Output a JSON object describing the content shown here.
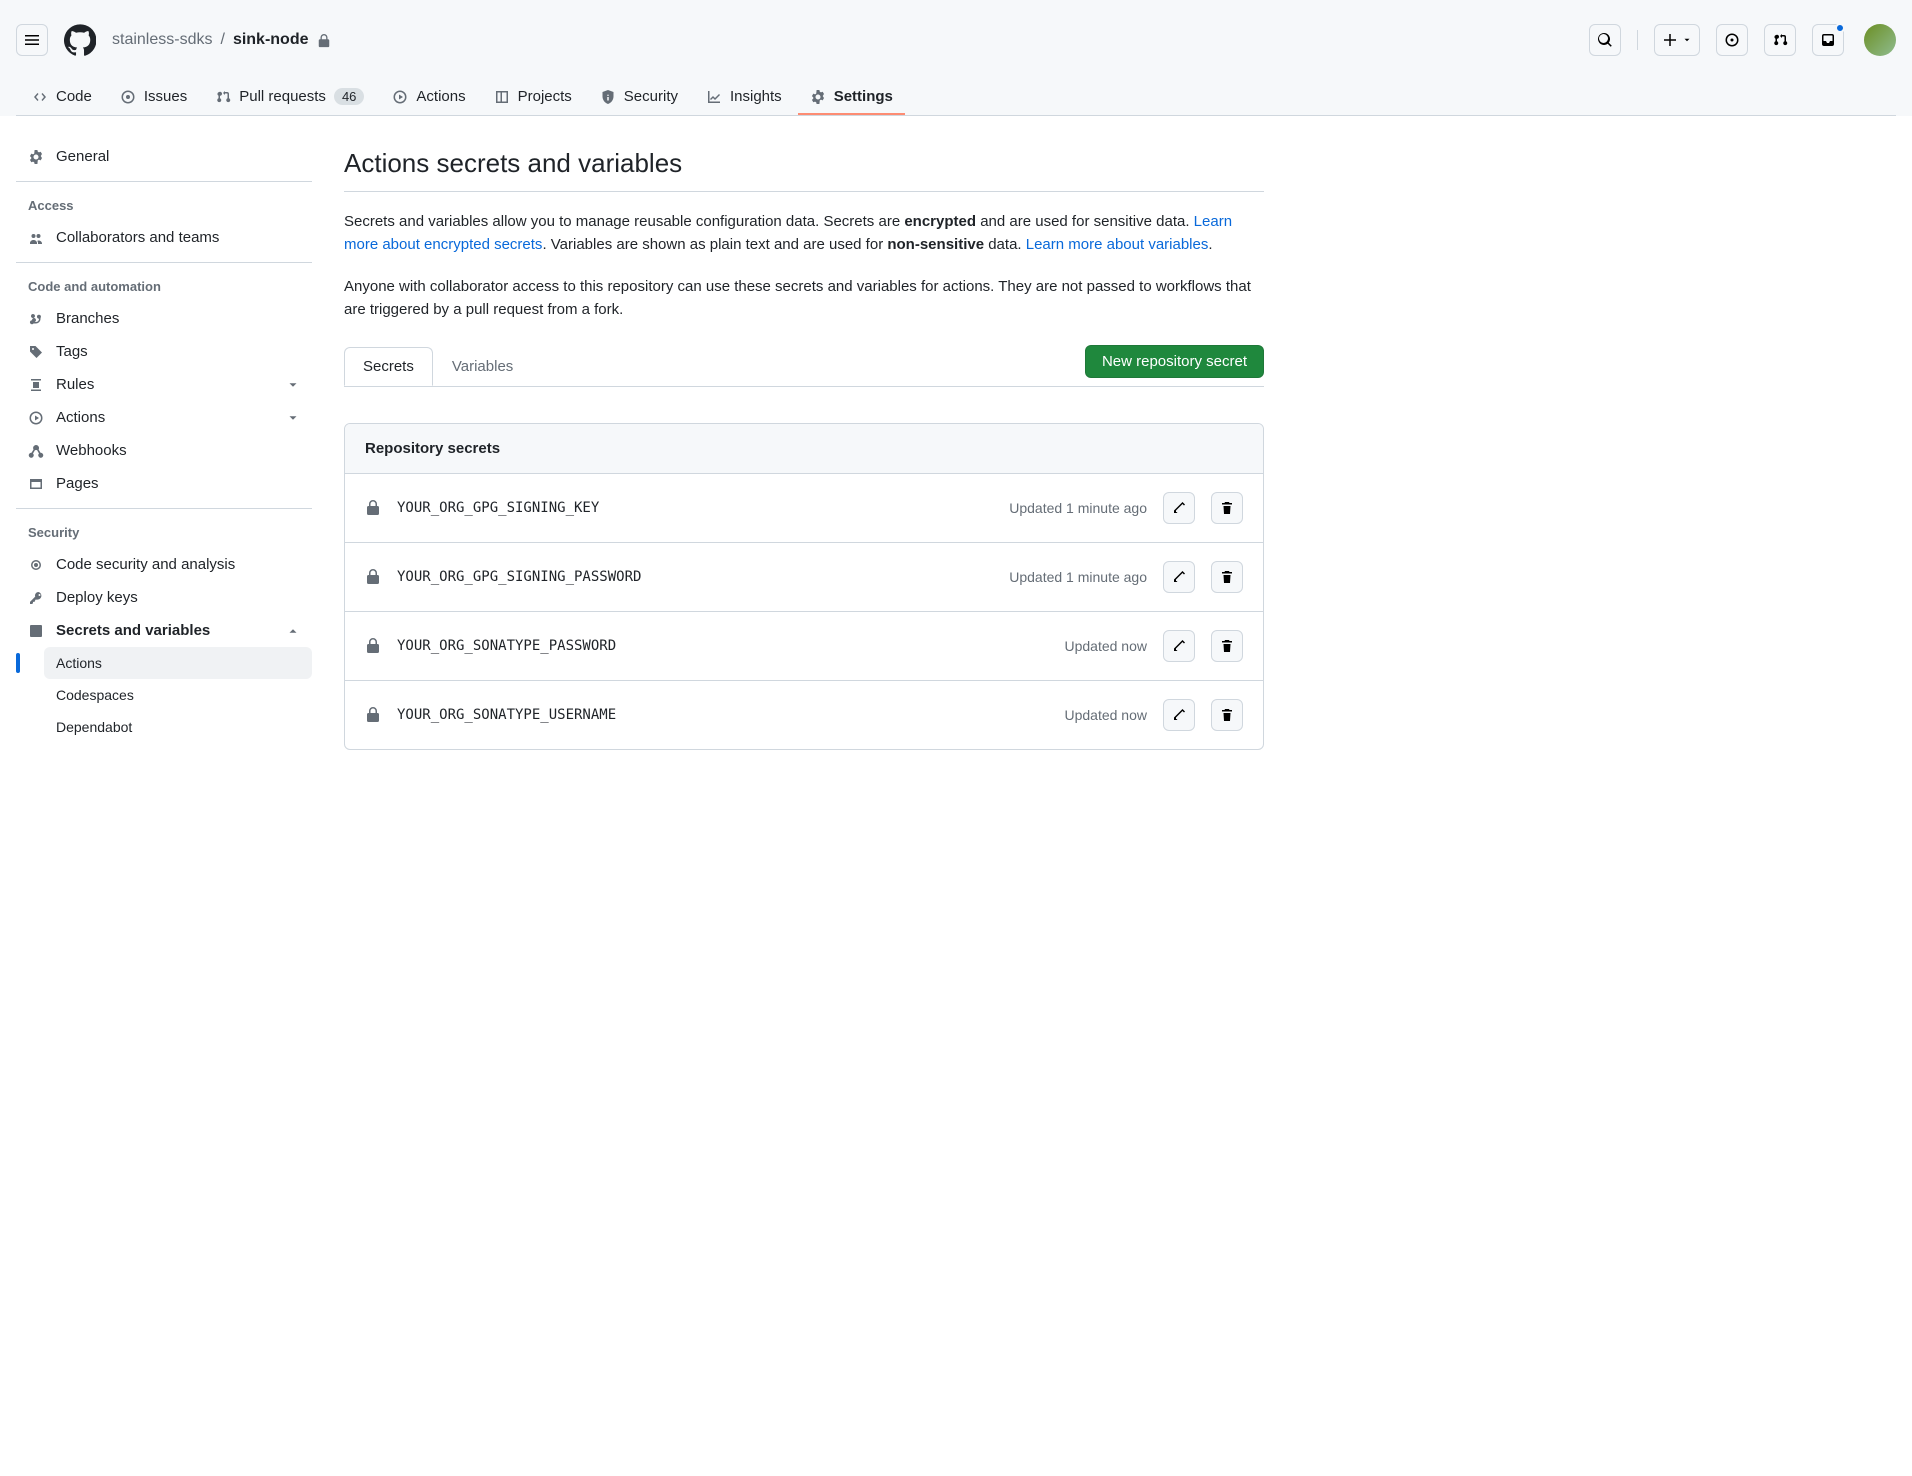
{
  "header": {
    "owner": "stainless-sdks",
    "separator": "/",
    "repo": "sink-node"
  },
  "repoNav": {
    "code": "Code",
    "issues": "Issues",
    "pulls": "Pull requests",
    "pulls_count": "46",
    "actions": "Actions",
    "projects": "Projects",
    "security": "Security",
    "insights": "Insights",
    "settings": "Settings"
  },
  "sidebar": {
    "general": "General",
    "access_hdr": "Access",
    "collaborators": "Collaborators and teams",
    "code_auto_hdr": "Code and automation",
    "branches": "Branches",
    "tags": "Tags",
    "rules": "Rules",
    "actions": "Actions",
    "webhooks": "Webhooks",
    "pages": "Pages",
    "security_hdr": "Security",
    "code_security": "Code security and analysis",
    "deploy_keys": "Deploy keys",
    "secrets": "Secrets and variables",
    "sub_actions": "Actions",
    "sub_codespaces": "Codespaces",
    "sub_dependabot": "Dependabot"
  },
  "main": {
    "title": "Actions secrets and variables",
    "desc1_a": "Secrets and variables allow you to manage reusable configuration data. Secrets are ",
    "desc1_b_strong": "encrypted",
    "desc1_c": " and are used for sensitive data. ",
    "desc1_link1": "Learn more about encrypted secrets",
    "desc1_d": ". Variables are shown as plain text and are used for ",
    "desc1_e_strong": "non-sensitive",
    "desc1_f": " data. ",
    "desc1_link2": "Learn more about variables",
    "desc1_g": ".",
    "desc2": "Anyone with collaborator access to this repository can use these secrets and variables for actions. They are not passed to workflows that are triggered by a pull request from a fork.",
    "tab_secrets": "Secrets",
    "tab_variables": "Variables",
    "new_button": "New repository secret",
    "box_header": "Repository secrets",
    "secrets": [
      {
        "name": "YOUR_ORG_GPG_SIGNING_KEY",
        "updated": "Updated 1 minute ago"
      },
      {
        "name": "YOUR_ORG_GPG_SIGNING_PASSWORD",
        "updated": "Updated 1 minute ago"
      },
      {
        "name": "YOUR_ORG_SONATYPE_PASSWORD",
        "updated": "Updated now"
      },
      {
        "name": "YOUR_ORG_SONATYPE_USERNAME",
        "updated": "Updated now"
      }
    ]
  }
}
